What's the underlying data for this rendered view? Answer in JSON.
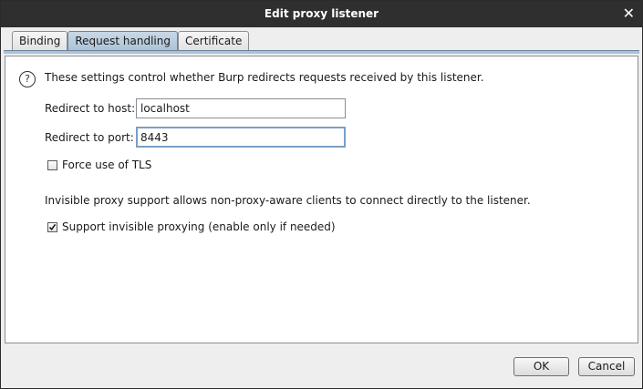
{
  "window": {
    "title": "Edit proxy listener"
  },
  "tabs": [
    {
      "label": "Binding",
      "active": false
    },
    {
      "label": "Request handling",
      "active": true
    },
    {
      "label": "Certificate",
      "active": false
    }
  ],
  "request_handling": {
    "help_icon_glyph": "?",
    "description": "These settings control whether Burp redirects requests received by this listener.",
    "redirect_host_label": "Redirect to host:",
    "redirect_host_value": "localhost",
    "redirect_port_label": "Redirect to port:",
    "redirect_port_value": "8443",
    "force_tls_label": "Force use of TLS",
    "force_tls_checked": false,
    "invisible_description": "Invisible proxy support allows non-proxy-aware clients to connect directly to the listener.",
    "invisible_label": "Support invisible proxying (enable only if needed)",
    "invisible_checked": true
  },
  "footer": {
    "ok_label": "OK",
    "cancel_label": "Cancel"
  },
  "colors": {
    "titlebar": "#2f2f2f",
    "active_tab": "#aac2d7",
    "panel_bg": "#ffffff",
    "window_bg": "#eeeeee"
  }
}
